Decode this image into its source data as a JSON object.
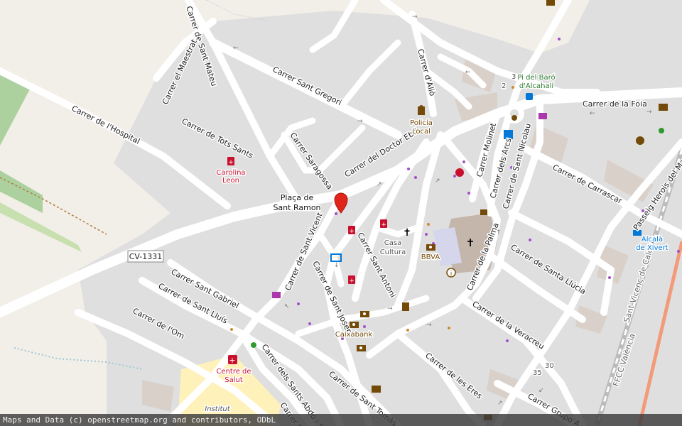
{
  "map": {
    "attribution": "Maps and Data (c) openstreetmap.org and contributors, ODbL",
    "colors": {
      "background": "#f2efe9",
      "residential": "#e0dfdf",
      "road": "#ffffff",
      "pharmacy": "#c8102e",
      "pin": "#e0261b",
      "poi": "#734a08",
      "amenity": "#0078d7",
      "park": "#8fc98f",
      "rail": "#999999"
    },
    "pin_icon": "map-pin-icon",
    "streets": {
      "sant_mateu": "Carrer de Sant Mateu",
      "el_maestrat": "Carrer el Maestrat",
      "hospital": "Carrer de l'Hospital",
      "tots_sants": "Carrer de Tots Sants",
      "sant_gregori": "Carrer Sant Gregori",
      "saragossa": "Carrer Saragossa",
      "doctor_ebri": "Carrer del Doctor Ebri",
      "alio": "Carrer d'Aliò",
      "foia": "Carrer de la Foia",
      "molinet": "Carrer Molinet",
      "arcs": "Carrer dels Arcs",
      "sant_nicolau": "Carrer de Sant Nicolau",
      "carrascar": "Carrer de Carrascar",
      "herois": "Passeig Herois del Marroc",
      "cv1331": "CV-1331",
      "sant_vicent": "Carrer de Sant Vicent",
      "sant_antoni": "Carrer Sant Antoni",
      "sant_josep": "Carrer de Sant Josep",
      "sant_gabriel": "Carrer Sant Gabriel",
      "sant_lluis": "Carrer de Sant Lluís",
      "om": "Carrer de l'Om",
      "la_palma": "Carrer de la Palma",
      "santa_llucia": "Carrer de Santa Llúcia",
      "veracreu": "Carrer de la Veracreu",
      "sants_abdo": "Carrer dels Sants Abdó i Senén",
      "les_eres": "Carrer de les Eres",
      "sant_tomas": "Carrer de Sant Tomàs",
      "grupo": "Carrer Grupo A",
      "calle_fr": "Carrer Fr",
      "sant_vicenc": "Sant Vicenç de Calders",
      "ffcc": "FFCC València"
    },
    "labels": {
      "pi_baro": "Pi del Baró",
      "alcahali": "d'Alcahalí",
      "policia_1": "Policía",
      "policia_2": "Local",
      "carolina_1": "Carolina",
      "carolina_2": "Leon",
      "placa_1": "Plaça de",
      "placa_2": "Sant Ramon",
      "casa_1": "Casa",
      "casa_2": "Cultura",
      "bbva": "BBVA",
      "caixabank": "Caixabank",
      "centre_1": "Centre de",
      "centre_2": "Salut",
      "institut": "Institut",
      "alcala_1": "Alcalà",
      "alcala_2": "de Xivert",
      "num_3": "3",
      "num_2": "2",
      "num_30": "30",
      "num_35": "35"
    }
  }
}
